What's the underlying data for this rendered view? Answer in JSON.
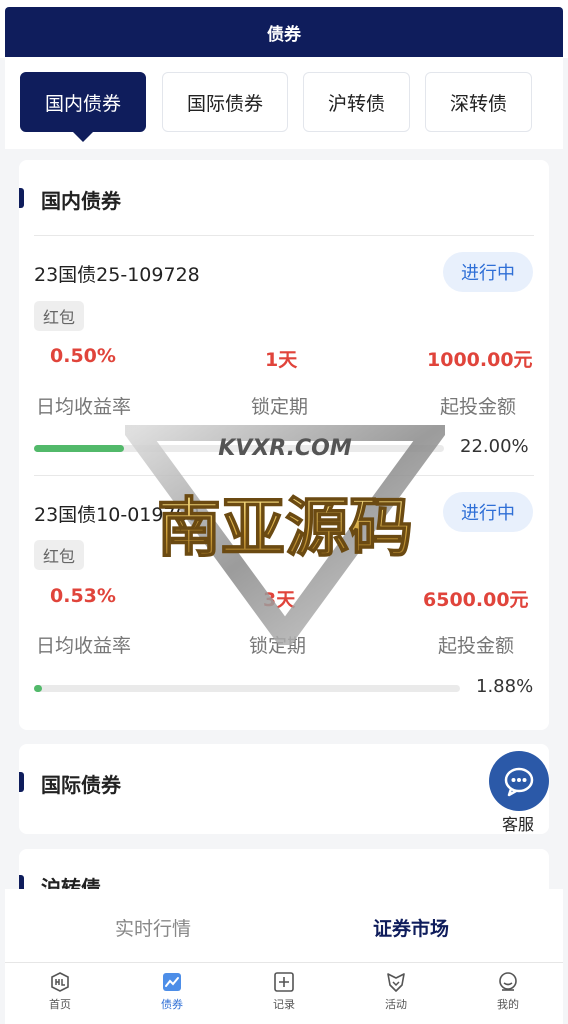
{
  "header": {
    "title": "债券"
  },
  "tabs": [
    {
      "label": "国内债券",
      "active": true
    },
    {
      "label": "国际债券",
      "active": false
    },
    {
      "label": "沪转债",
      "active": false
    },
    {
      "label": "深转债",
      "active": false
    }
  ],
  "sections": {
    "domestic": {
      "title": "国内债券",
      "bonds": [
        {
          "name": "23国债25-109728",
          "status": "进行中",
          "tag": "红包",
          "rate": "0.50%",
          "rate_label": "日均收益率",
          "lock": "1天",
          "lock_label": "锁定期",
          "min": "1000.00元",
          "min_label": "起投金额",
          "progress_text": "22.00%",
          "progress": 0.22
        },
        {
          "name": "23国债10-019708",
          "status": "进行中",
          "tag": "红包",
          "rate": "0.53%",
          "rate_label": "日均收益率",
          "lock": "3天",
          "lock_label": "锁定期",
          "min": "6500.00元",
          "min_label": "起投金额",
          "progress_text": "1.88%",
          "progress": 0.0188
        }
      ]
    },
    "international": {
      "title": "国际债券"
    },
    "shanghai": {
      "title": "沪转债"
    }
  },
  "customer_service": {
    "label": "客服",
    "icon": "chat-icon"
  },
  "subtabs": [
    {
      "label": "实时行情",
      "active": false
    },
    {
      "label": "证券市场",
      "active": true
    }
  ],
  "bottom_nav": [
    {
      "label": "首页",
      "icon": "home-icon",
      "active": false
    },
    {
      "label": "债券",
      "icon": "chart-icon",
      "active": true
    },
    {
      "label": "记录",
      "icon": "record-icon",
      "active": false
    },
    {
      "label": "活动",
      "icon": "activity-icon",
      "active": false
    },
    {
      "label": "我的",
      "icon": "profile-icon",
      "active": false
    }
  ],
  "watermark": {
    "top_text": "KVXR.COM",
    "main_text": "南亚源码"
  },
  "colors": {
    "primary": "#0f1d5c",
    "accent_red": "#e0443b",
    "status_blue": "#2f6fd6",
    "progress_green": "#52b96a"
  }
}
